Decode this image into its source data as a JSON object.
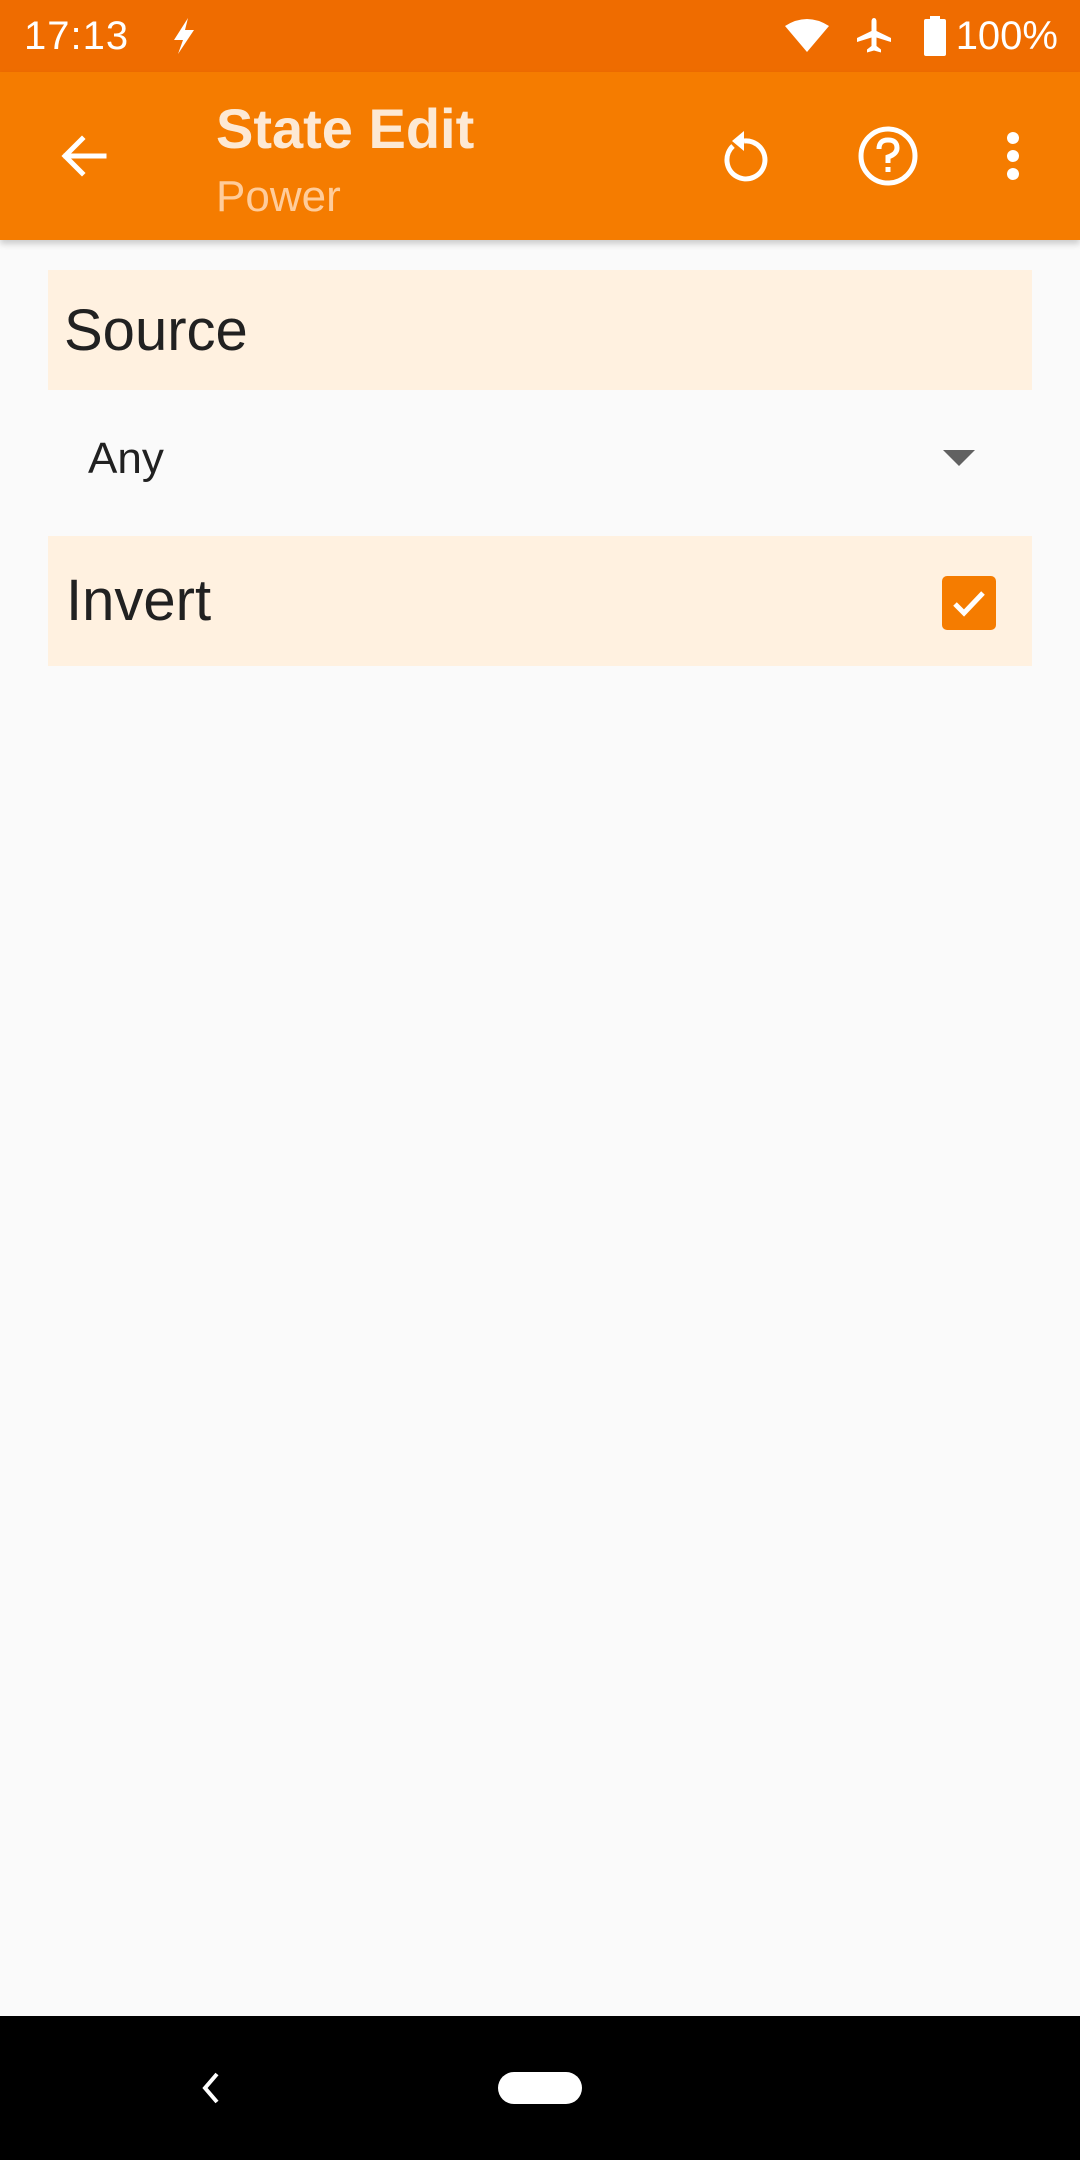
{
  "status_bar": {
    "time": "17:13",
    "battery_text": "100%",
    "icons": [
      "flash-icon",
      "wifi-icon",
      "airplane-icon",
      "battery-icon"
    ]
  },
  "app_bar": {
    "title": "State Edit",
    "subtitle": "Power",
    "icons": [
      "arrow-back-icon",
      "revert-icon",
      "help-icon",
      "more-vert-icon"
    ]
  },
  "source": {
    "header": "Source",
    "selected_value": "Any"
  },
  "invert": {
    "label": "Invert",
    "checked": true
  },
  "nav_bar": {
    "icons": [
      "nav-back-icon",
      "nav-home-pill"
    ]
  },
  "colors": {
    "status_bar": "#ef6c00",
    "app_bar": "#f57c00",
    "section_background": "#fff1e0",
    "accent": "#f57c00"
  }
}
